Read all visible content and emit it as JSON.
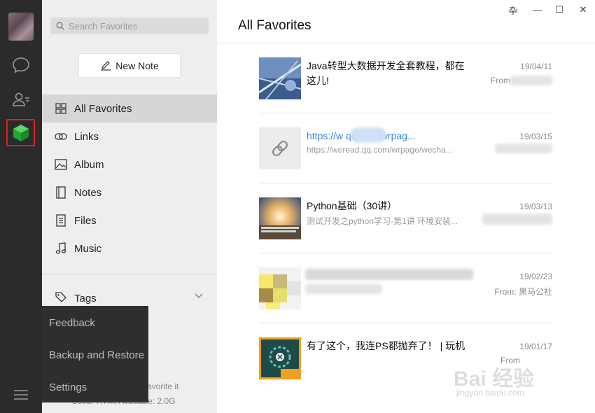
{
  "window": {
    "pin": "卆",
    "minimize": "—",
    "maximize": "☐",
    "close": "✕"
  },
  "rail": {
    "icons": [
      "avatar",
      "chat-icon",
      "contacts-icon",
      "favorites-icon",
      "menu-icon"
    ]
  },
  "panel": {
    "search_placeholder": "Search Favorites",
    "new_note": "New Note",
    "nav": [
      {
        "label": "All Favorites",
        "icon": "grid-icon",
        "active": true
      },
      {
        "label": "Links",
        "icon": "link-icon"
      },
      {
        "label": "Album",
        "icon": "album-icon"
      },
      {
        "label": "Notes",
        "icon": "notes-icon"
      },
      {
        "label": "Files",
        "icon": "files-icon"
      },
      {
        "label": "Music",
        "icon": "music-icon"
      }
    ],
    "tags": "Tags",
    "storage_line1": "avorite it",
    "storage_line2": "Used: 7.7M, Available: 2.0G"
  },
  "popup": {
    "items": [
      "Feedback",
      "Backup and Restore",
      "Settings"
    ]
  },
  "main": {
    "title": "All Favorites",
    "items": [
      {
        "title": "Java转型大数据开发全套教程，都在这儿!",
        "subtitle": "",
        "date": "19/04/11",
        "from": "From"
      },
      {
        "title": "https://w          qq.com/wrpag...",
        "subtitle": "https://weread.qq.com/wrpage/wecha...",
        "date": "19/03/15",
        "from": ""
      },
      {
        "title": "Python基础（30讲）",
        "subtitle": "测试开发之python学习-第1讲 环境安装...",
        "date": "19/03/13",
        "from": ""
      },
      {
        "title": "",
        "subtitle": "",
        "date": "19/02/23",
        "from": "From: 黑马公社"
      },
      {
        "title": "有了这个，我连PS都抛弃了！ | 玩机",
        "subtitle": "",
        "date": "19/01/17",
        "from": "From"
      }
    ]
  },
  "watermark": {
    "text": "Bai 经验",
    "sub": "jingyan.baidu.com"
  },
  "colors": {
    "rail": "#2b2b2b",
    "panel": "#eeeeee",
    "active": "#d6d6d6",
    "highlight": "#e02020",
    "favorites_green": "#2aae3b",
    "link": "#3a84d8"
  }
}
